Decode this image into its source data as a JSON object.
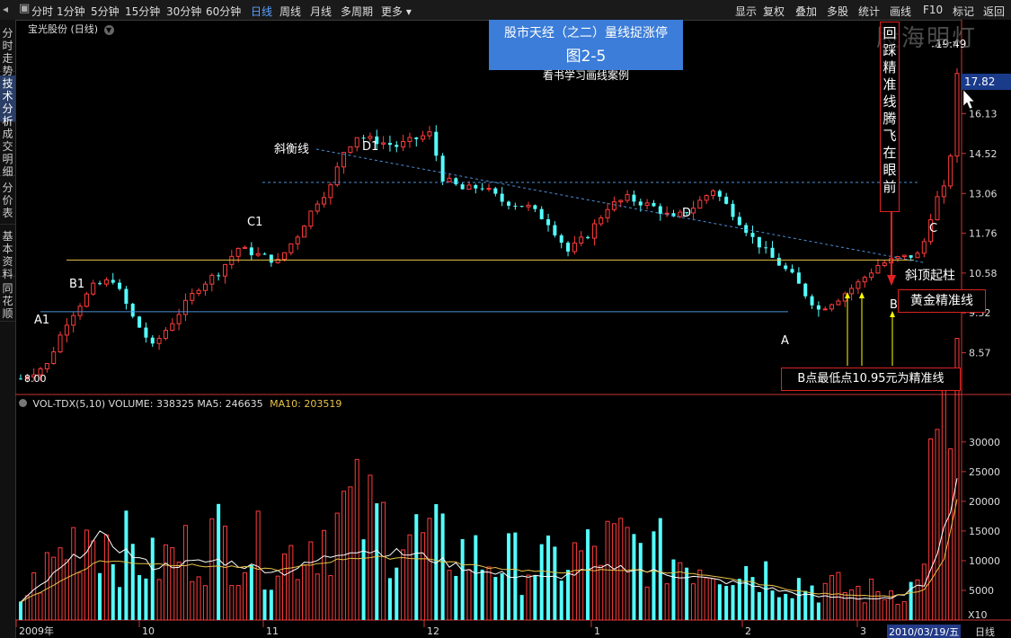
{
  "toolbar": {
    "periods": [
      "分时",
      "1分钟",
      "5分钟",
      "15分钟",
      "30分钟",
      "60分钟",
      "日线",
      "周线",
      "月线",
      "多周期",
      "更多"
    ],
    "active_period": "日线",
    "right_buttons": [
      "显示",
      "复权",
      "叠加",
      "多股",
      "统计",
      "画线",
      "F10",
      "标记",
      "返回"
    ]
  },
  "sidebar": {
    "tabs": [
      "分时走势",
      "技术分析",
      "成交明细",
      "分价表",
      "基本资料",
      "同花顺"
    ],
    "active_tab": "技术分析"
  },
  "chart": {
    "stock_title": "宝光股份 (日线)",
    "title_box": {
      "line1": "股市天经（之二）量线捉涨停",
      "line2": "图2-5",
      "line3": "看书学习画线案例"
    },
    "watermark": "股海明灯",
    "price_axis": [
      "16.13",
      "14.52",
      "13.06",
      "11.76",
      "10.58",
      "9.52",
      "8.57"
    ],
    "current_price": "17.82",
    "high_label": "19.49",
    "low_label": "8.00",
    "annotations": {
      "xieheng": "斜衡线",
      "d1": "D1",
      "c1": "C1",
      "b1": "B1",
      "a1": "A1",
      "d": "D",
      "a": "A",
      "b": "B",
      "c": "C",
      "xieding": "斜顶起柱",
      "gold_line": "黄金精准线",
      "b_note": "B点最低点10.95元为精准线",
      "vertical_note": "回踩精准线腾飞在眼前"
    }
  },
  "volume": {
    "header_main": "VOL-TDX(5,10)  VOLUME: 338325  MA5: 246635",
    "header_ma10": "MA10: 203519",
    "axis": [
      "30000",
      "25000",
      "20000",
      "15000",
      "10000",
      "5000"
    ],
    "unit": "X10"
  },
  "date_axis": [
    "2009年",
    "10",
    "11",
    "12",
    "1",
    "2",
    "3"
  ],
  "date_cursor": "2010/03/19/五",
  "period_label": "日线",
  "colors": {
    "up": "#ff3c3c",
    "down": "#54ffff",
    "gold": "#e8c34a",
    "blue_line": "#4a90d9",
    "title_bg": "#3b7dd8"
  }
}
